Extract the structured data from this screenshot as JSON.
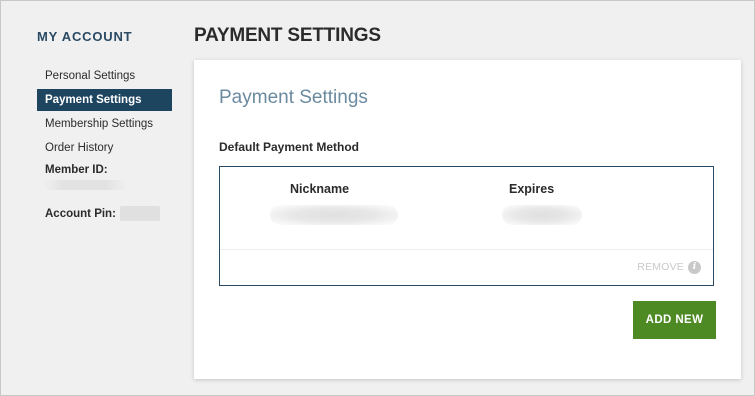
{
  "sidebar": {
    "heading": "MY ACCOUNT",
    "items": [
      {
        "label": "Personal Settings",
        "active": false
      },
      {
        "label": "Payment Settings",
        "active": true
      },
      {
        "label": "Membership Settings",
        "active": false
      },
      {
        "label": "Order History",
        "active": false
      }
    ],
    "member_id_label": "Member ID:",
    "account_pin_label": "Account Pin:"
  },
  "page": {
    "title": "PAYMENT SETTINGS"
  },
  "card": {
    "title": "Payment Settings",
    "section_label": "Default Payment Method",
    "table": {
      "columns": [
        "Nickname",
        "Expires"
      ]
    },
    "remove_label": "REMOVE",
    "info_icon": "info-icon",
    "add_new_label": "ADD NEW"
  },
  "colors": {
    "accent": "#1e4560",
    "primary_button": "#4e8a23",
    "card_title": "#6a8aa0"
  }
}
